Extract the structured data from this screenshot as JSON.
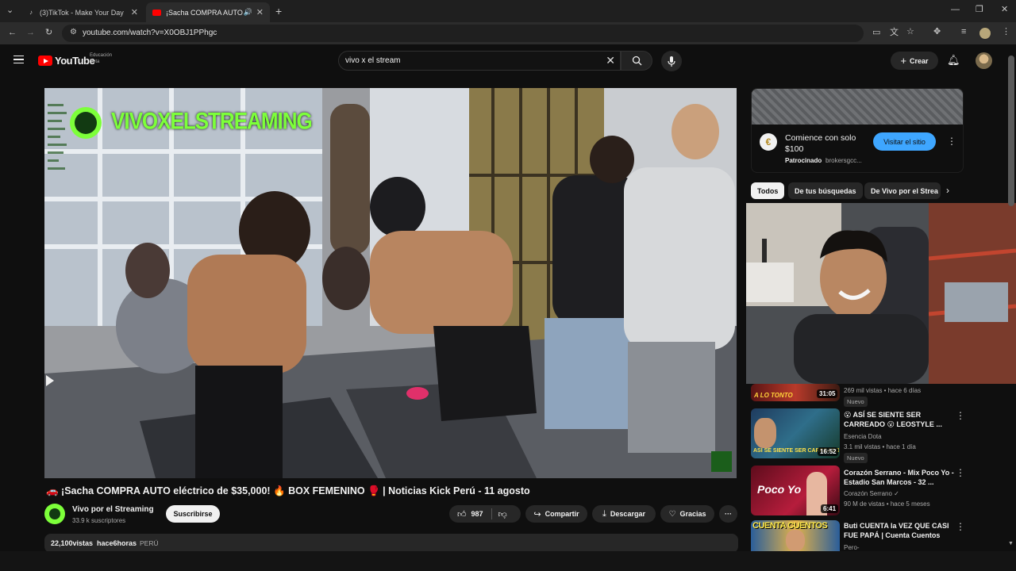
{
  "browser": {
    "tabs": [
      {
        "title": "(3)TikTok - Make Your Day"
      },
      {
        "title": "¡Sacha COMPRA AUTO"
      }
    ],
    "url": "youtube.com/watch?v=X0OBJ1PPhgc"
  },
  "youtube": {
    "logo_text": "YouTube",
    "logo_sub1": "Educación",
    "logo_sub2": "Beta",
    "search_value": "vivo x el stream",
    "create_label": "Crear"
  },
  "video": {
    "watermark": "VIVOXELSTREAMING",
    "title": "🚗 ¡Sacha COMPRA AUTO eléctrico de $35,000! 🔥 BOX FEMENINO 🥊 | Noticias Kick Perú - 11 agosto",
    "channel": "Vivo por el Streaming",
    "subscribers": "33.9 k suscriptores",
    "subscribe_label": "Suscribirse",
    "likes": "987",
    "share_label": "Compartir",
    "download_label": "Descargar",
    "thanks_label": "Gracias",
    "more_label": "···",
    "views": "22,100vistas",
    "age": "hace6horas",
    "country": "PERÚ"
  },
  "ad": {
    "title": "Comience con solo $100",
    "sponsored": "Patrocinado",
    "domain": "brokersgcc...",
    "cta": "Visitar el sitio"
  },
  "chips": [
    "Todos",
    "De tus búsquedas",
    "De Vivo por el Strea"
  ],
  "recommendations": [
    {
      "thumb_text": "A LO TONTO",
      "duration": "31:05",
      "meta": "269 mil vistas • hace 6 días",
      "badge": "Nuevo"
    },
    {
      "thumb_text": "ASÍ SE SIENTE SER CARREADO",
      "title": "😮 ASÍ SE SIENTE SER CARREADO 😮 LEOSTYLE ...",
      "channel": "Esencia Dota",
      "meta": "3.1 mil vistas • hace 1 día",
      "badge": "Nuevo",
      "duration": "16:52"
    },
    {
      "thumb_text": "Poco Yo",
      "title": "Corazón Serrano - Mix Poco Yo - Estadio San Marcos - 32 ...",
      "channel": "Corazón Serrano ✓",
      "meta": "90 M de vistas • hace 5 meses",
      "duration": "6:41"
    },
    {
      "thumb_text": "CUENTA CUENTOS",
      "title": "Buti CUENTA la VEZ QUE CASI FUE PAPÁ | Cuenta Cuentos",
      "channel": "Pero-"
    }
  ],
  "colors": {
    "accent_red": "#ff0000",
    "cta_blue": "#3ea6ff",
    "watermark_green": "#7dff3a"
  }
}
